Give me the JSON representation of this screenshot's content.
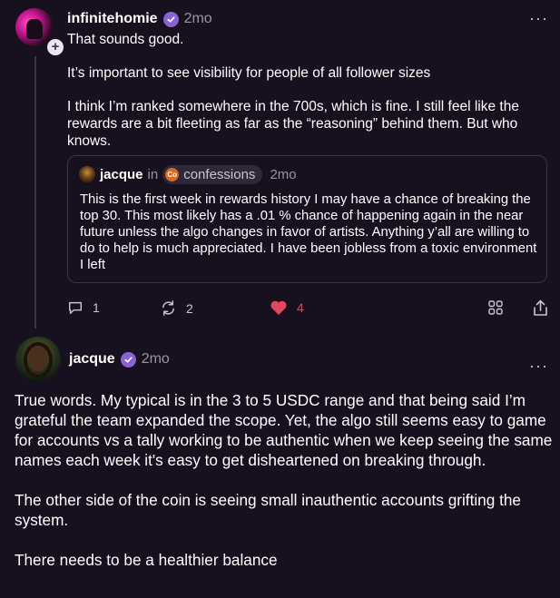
{
  "post1": {
    "username": "infinitehomie",
    "timestamp": "2mo",
    "more": "···",
    "plus": "+",
    "paragraphs": [
      "That sounds good.",
      "It’s important to see visibility for people of all follower sizes",
      "I think I’m ranked somewhere in the 700s, which is fine. I still feel like the rewards are a bit fleeting as far as the “reasoning” behind them. But who knows."
    ],
    "quote": {
      "username": "jacque",
      "in_text": "in",
      "channel_icon_text": "Co",
      "channel": "confessions",
      "timestamp": "2mo",
      "text": "This is the first week in rewards history I may have a chance of breaking the top 30. This most likely has a .01 % chance of happening again in the near future unless the algo changes in favor of artists. Anything y’all are willing to do to help is much appreciated. I have been jobless from a toxic environment I left"
    },
    "actions": {
      "replies": "1",
      "recasts": "2",
      "likes": "4"
    }
  },
  "post2": {
    "username": "jacque",
    "timestamp": "2mo",
    "more": "···",
    "paragraphs": [
      "True words. My typical is in the 3 to 5 USDC range and that being said I’m grateful the team expanded the scope. Yet, the algo still seems easy to game for accounts vs a tally working to be authentic when we keep seeing the same names each week it's easy to get disheartened on breaking through.",
      "The other side of the coin is seeing small inauthentic accounts grifting the system.",
      "There needs to be a healthier balance"
    ]
  },
  "colors": {
    "background": "#17101f",
    "verified": "#8a63d2",
    "like": "#e2475f",
    "muted": "#9a93a6"
  },
  "icons": [
    "verified-badge-icon",
    "more-icon",
    "reply-icon",
    "recast-icon",
    "heart-icon",
    "grid-icon",
    "share-icon"
  ]
}
